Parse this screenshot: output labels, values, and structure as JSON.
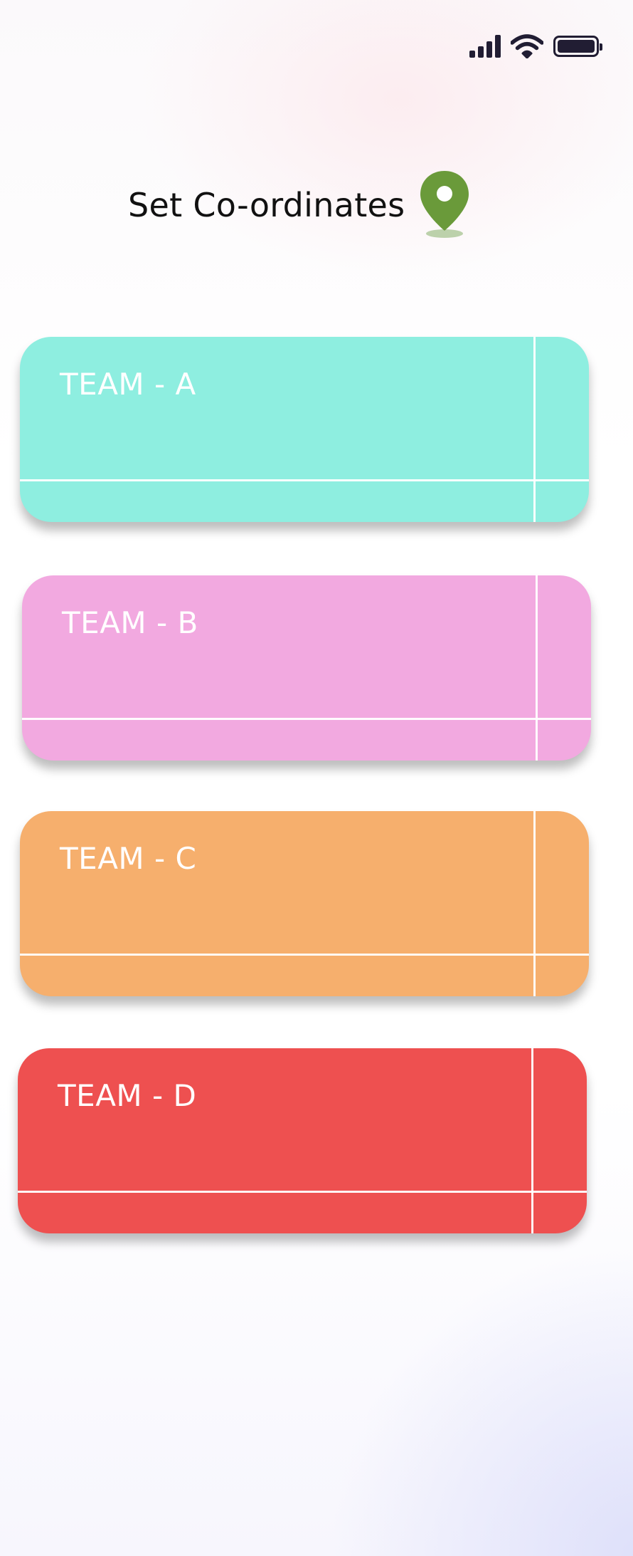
{
  "header": {
    "title": "Set Co-ordinates",
    "icon": "location-pin-icon",
    "icon_color": "#6a9a3a"
  },
  "status_bar": {
    "icons": [
      "signal-icon",
      "wifi-icon",
      "battery-icon"
    ],
    "icon_color": "#211d33"
  },
  "teams": [
    {
      "label": "TEAM - A",
      "color": "#8eeee0"
    },
    {
      "label": "TEAM - B",
      "color": "#f2a9e0"
    },
    {
      "label": "TEAM - C",
      "color": "#f6af6d"
    },
    {
      "label": "TEAM - D",
      "color": "#ee5050"
    }
  ]
}
